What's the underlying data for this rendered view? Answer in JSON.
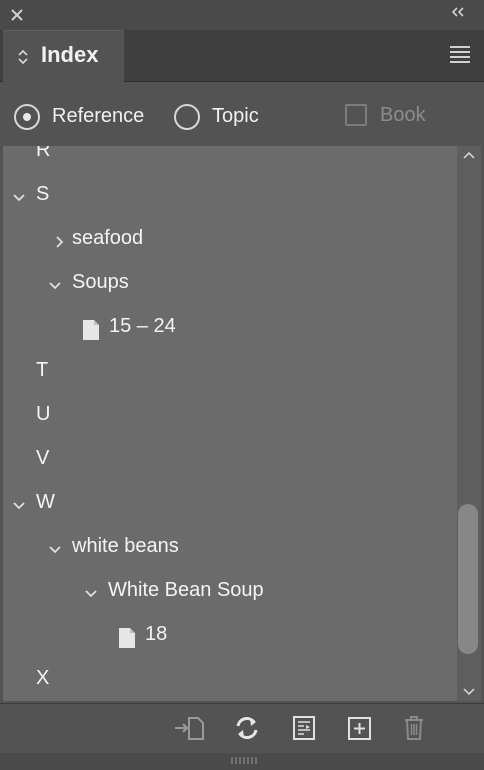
{
  "panel": {
    "tab_label": "Index"
  },
  "options": {
    "reference_label": "Reference",
    "topic_label": "Topic",
    "book_label": "Book"
  },
  "index_rows": [
    {
      "text": "R"
    },
    {
      "text": "S"
    },
    {
      "text": "seafood"
    },
    {
      "text": "Soups"
    },
    {
      "text": "15 – 24"
    },
    {
      "text": "T"
    },
    {
      "text": "U"
    },
    {
      "text": "V"
    },
    {
      "text": "W"
    },
    {
      "text": "white beans"
    },
    {
      "text": "White Bean Soup"
    },
    {
      "text": "18"
    },
    {
      "text": "X"
    }
  ],
  "footer_buttons": [
    "go-to-reference-icon",
    "update-preview-icon",
    "generate-index-icon",
    "new-entry-icon",
    "delete-entry-icon"
  ],
  "colors": {
    "panel_bg": "#535353",
    "list_bg": "#6b6b6b",
    "text": "#f4f4f4"
  }
}
